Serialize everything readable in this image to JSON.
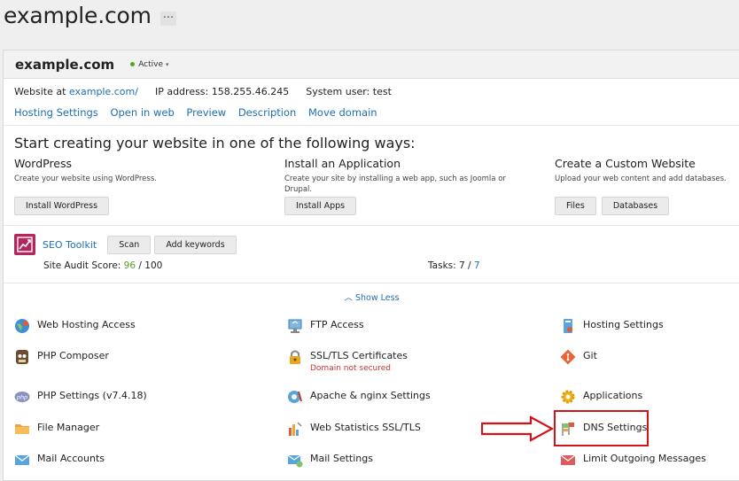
{
  "page": {
    "title": "example.com",
    "more_label": "···"
  },
  "card": {
    "domain": "example.com",
    "status": "Active",
    "website_at_label": "Website at",
    "website_url": "example.com/",
    "ip_label": "IP address:",
    "ip_value": "158.255.46.245",
    "user_label": "System user:",
    "user_value": "test"
  },
  "links": [
    "Hosting Settings",
    "Open in web",
    "Preview",
    "Description",
    "Move domain"
  ],
  "start": {
    "title": "Start creating your website in one of the following ways:",
    "ways": [
      {
        "title": "WordPress",
        "desc": "Create your website using WordPress.",
        "buttons": [
          "Install WordPress"
        ]
      },
      {
        "title": "Install an Application",
        "desc": "Create your site by installing a web app, such as Joomla or Drupal.",
        "buttons": [
          "Install Apps"
        ]
      },
      {
        "title": "Create a Custom Website",
        "desc": "Upload your web content and add databases.",
        "buttons": [
          "Files",
          "Databases"
        ]
      }
    ]
  },
  "seo": {
    "name": "SEO Toolkit",
    "scan_label": "Scan",
    "keywords_label": "Add keywords",
    "audit_label": "Site Audit Score:",
    "audit_score": "96",
    "audit_max": "/ 100",
    "tasks_label": "Tasks:",
    "tasks_done": "7 /",
    "tasks_total": "7"
  },
  "show_less": "Show Less",
  "tools": [
    {
      "label": "Web Hosting Access",
      "icon": "globe-user-icon"
    },
    {
      "label": "FTP Access",
      "icon": "ftp-monitor-icon"
    },
    {
      "label": "Hosting Settings",
      "icon": "hosting-settings-icon"
    },
    {
      "label": "PHP Composer",
      "icon": "composer-icon"
    },
    {
      "label": "SSL/TLS Certificates",
      "icon": "lock-icon",
      "sub": "Domain not secured"
    },
    {
      "label": "Git",
      "icon": "git-icon"
    },
    {
      "label": "PHP Settings (v7.4.18)",
      "icon": "php-icon"
    },
    {
      "label": "Apache & nginx Settings",
      "icon": "apache-icon"
    },
    {
      "label": "Applications",
      "icon": "gear-icon"
    },
    {
      "label": "File Manager",
      "icon": "folder-icon"
    },
    {
      "label": "Web Statistics SSL/TLS",
      "icon": "stats-icon"
    },
    {
      "label": "DNS Settings",
      "icon": "dns-flags-icon"
    },
    {
      "label": "Mail Accounts",
      "icon": "mail-icon"
    },
    {
      "label": "Mail Settings",
      "icon": "mail-settings-icon"
    },
    {
      "label": "Limit Outgoing Messages",
      "icon": "mail-limit-icon"
    }
  ],
  "colors": {
    "link": "#1f6fb4",
    "active": "#5aa02c",
    "highlight": "#d3131a",
    "error": "#d0312d"
  }
}
